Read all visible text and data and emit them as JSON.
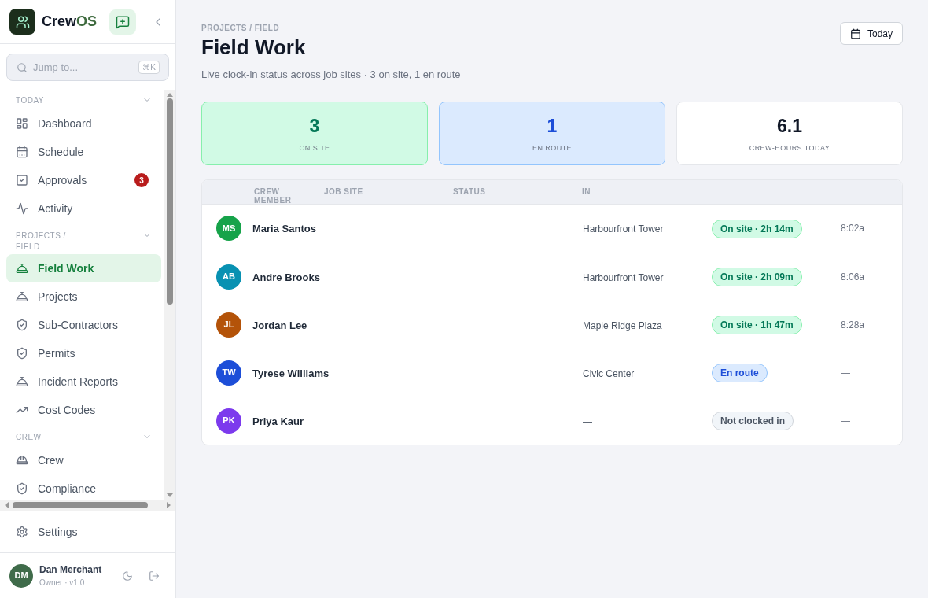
{
  "brand": {
    "name_a": "Crew",
    "name_b": "OS"
  },
  "search": {
    "placeholder": "Jump to...",
    "shortcut": "⌘K"
  },
  "nav": [
    {
      "label": "TODAY",
      "expanded": true,
      "items": [
        {
          "label": "Dashboard",
          "kind": "dashboard",
          "selected": false
        },
        {
          "label": "Schedule",
          "kind": "calendar",
          "selected": false
        },
        {
          "label": "Approvals",
          "kind": "check",
          "selected": false,
          "badge": "3"
        },
        {
          "label": "Activity",
          "kind": "activity",
          "selected": false
        }
      ]
    },
    {
      "label": "PROJECTS / FIELD",
      "expanded": true,
      "items": [
        {
          "label": "Field Work",
          "kind": "bell",
          "selected": true
        },
        {
          "label": "Projects",
          "kind": "bell",
          "selected": false
        },
        {
          "label": "Sub-Contractors",
          "kind": "shield",
          "selected": false
        },
        {
          "label": "Permits",
          "kind": "shield",
          "selected": false
        },
        {
          "label": "Incident Reports",
          "kind": "bell",
          "selected": false
        },
        {
          "label": "Cost Codes",
          "kind": "trend",
          "selected": false
        }
      ]
    },
    {
      "label": "CREW",
      "expanded": true,
      "items": [
        {
          "label": "Crew",
          "kind": "hardhat",
          "selected": false
        },
        {
          "label": "Compliance",
          "kind": "shield",
          "selected": false
        }
      ]
    }
  ],
  "settings": {
    "label": "Settings"
  },
  "user": {
    "initials": "DM",
    "name": "Dan Merchant",
    "role": "Owner · v1.0"
  },
  "header": {
    "breadcrumb": "PROJECTS / FIELD",
    "title": "Field Work",
    "subtitle": "Live clock-in status across job sites · 3 on site, 1 en route",
    "date_button": "Today"
  },
  "stats": [
    {
      "value": "3",
      "label": "ON SITE",
      "kind": "green"
    },
    {
      "value": "1",
      "label": "EN ROUTE",
      "kind": "blue"
    },
    {
      "value": "6.1",
      "label": "CREW-HOURS TODAY",
      "kind": "plain"
    }
  ],
  "table": {
    "columns": [
      "CREW MEMBER",
      "JOB SITE",
      "STATUS",
      "IN"
    ],
    "rows": [
      {
        "initials": "MS",
        "color": "#16a34a",
        "name": "Maria Santos",
        "site": "Harbourfront Tower",
        "status": "On site · 2h 14m",
        "kind": "on_site",
        "time": "8:02a"
      },
      {
        "initials": "AB",
        "color": "#0891b2",
        "name": "Andre Brooks",
        "site": "Harbourfront Tower",
        "status": "On site · 2h 09m",
        "kind": "on_site",
        "time": "8:06a"
      },
      {
        "initials": "JL",
        "color": "#b45309",
        "name": "Jordan Lee",
        "site": "Maple Ridge Plaza",
        "status": "On site · 1h 47m",
        "kind": "on_site",
        "time": "8:28a"
      },
      {
        "initials": "TW",
        "color": "#1d4ed8",
        "name": "Tyrese Williams",
        "site": "Civic Center",
        "status": "En route",
        "kind": "en_route",
        "time": "—"
      },
      {
        "initials": "PK",
        "color": "#7c3aed",
        "name": "Priya Kaur",
        "site": "—",
        "status": "Not clocked in",
        "kind": "off",
        "time": "—"
      }
    ]
  }
}
